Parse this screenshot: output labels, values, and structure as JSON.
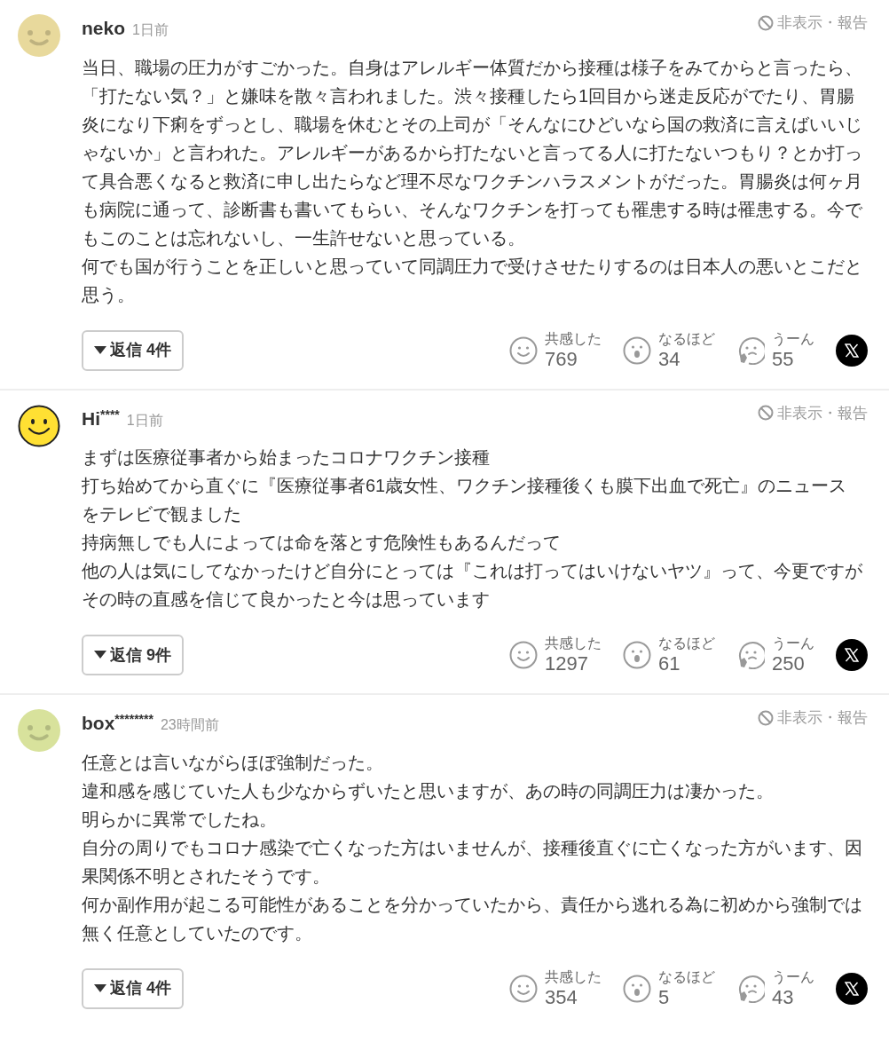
{
  "comments": [
    {
      "author": "neko",
      "avatar": {
        "kind": "plain",
        "color": "#e8d99c"
      },
      "time": "1日前",
      "hide_report": "非表示・報告",
      "paragraphs": [
        "当日、職場の圧力がすごかった。自身はアレルギー体質だから接種は様子をみてからと言ったら、「打たない気？」と嫌味を散々言われました。渋々接種したら1回目から迷走反応がでたり、胃腸炎になり下痢をずっとし、職場を休むとその上司が「そんなにひどいなら国の救済に言えばいいじゃないか」と言われた。アレルギーがあるから打たないと言ってる人に打たないつもり？とか打って具合悪くなると救済に申し出たらなど理不尽なワクチンハラスメントがだった。胃腸炎は何ヶ月も病院に通って、診断書も書いてもらい、そんなワクチンを打っても罹患する時は罹患する。今でもこのことは忘れないし、一生許せないと思っている。",
        "何でも国が行うことを正しいと思っていて同調圧力で受けさせたりするのは日本人の悪いとこだと思う。"
      ],
      "replies": "返信 4件",
      "reactions": [
        {
          "kind": "smile",
          "label": "共感した",
          "count": "769"
        },
        {
          "kind": "surprised",
          "label": "なるほど",
          "count": "34"
        },
        {
          "kind": "thinking",
          "label": "うーん",
          "count": "55"
        }
      ]
    },
    {
      "author": "Hi",
      "author_mask": "****",
      "avatar": {
        "kind": "outlined",
        "color": "#ffe033"
      },
      "time": "1日前",
      "hide_report": "非表示・報告",
      "paragraphs": [
        "まずは医療従事者から始まったコロナワクチン接種",
        "打ち始めてから直ぐに『医療従事者61歳女性、ワクチン接種後くも膜下出血で死亡』のニュースをテレビで観ました",
        "持病無しでも人によっては命を落とす危険性もあるんだって",
        "他の人は気にしてなかったけど自分にとっては『これは打ってはいけないヤツ』って、今更ですがその時の直感を信じて良かったと今は思っています"
      ],
      "replies": "返信 9件",
      "reactions": [
        {
          "kind": "smile",
          "label": "共感した",
          "count": "1297"
        },
        {
          "kind": "surprised",
          "label": "なるほど",
          "count": "61"
        },
        {
          "kind": "thinking",
          "label": "うーん",
          "count": "250"
        }
      ]
    },
    {
      "author": "box",
      "author_mask": "********",
      "avatar": {
        "kind": "plain",
        "color": "#d8e29c"
      },
      "time": "23時間前",
      "hide_report": "非表示・報告",
      "paragraphs": [
        "任意とは言いながらほぼ強制だった。",
        "違和感を感じていた人も少なからずいたと思いますが、あの時の同調圧力は凄かった。",
        "明らかに異常でしたね。",
        "自分の周りでもコロナ感染で亡くなった方はいませんが、接種後直ぐに亡くなった方がいます、因果関係不明とされたそうです。",
        "何か副作用が起こる可能性があることを分かっていたから、責任から逃れる為に初めから強制では無く任意としていたのです。"
      ],
      "replies": "返信 4件",
      "reactions": [
        {
          "kind": "smile",
          "label": "共感した",
          "count": "354"
        },
        {
          "kind": "surprised",
          "label": "なるほど",
          "count": "5"
        },
        {
          "kind": "thinking",
          "label": "うーん",
          "count": "43"
        }
      ]
    }
  ]
}
